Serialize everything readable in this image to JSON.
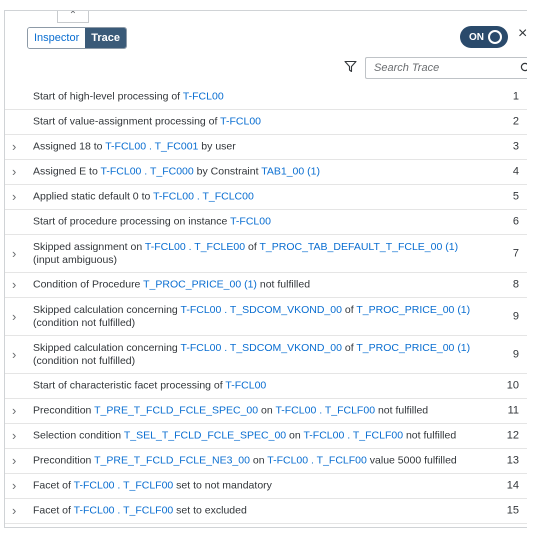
{
  "tabs": {
    "inspector": "Inspector",
    "trace": "Trace"
  },
  "toggle": {
    "label": "ON",
    "state": "on"
  },
  "search": {
    "placeholder": "Search Trace"
  },
  "icons": {
    "collapse": "chevron-up-icon",
    "close": "close-icon",
    "filter": "filter-icon",
    "search": "search-icon",
    "expand": "chevron-right-icon"
  },
  "colors": {
    "link": "#0a6ed1",
    "toggle_bg": "#2a4a6b",
    "active_tab": "#3a5a78"
  },
  "rows": [
    {
      "num": "1",
      "expandable": false,
      "segments": [
        {
          "t": "Start of high-level processing of "
        },
        {
          "t": "T-FCL00",
          "l": true
        }
      ]
    },
    {
      "num": "2",
      "expandable": false,
      "segments": [
        {
          "t": "Start of value-assignment processing of "
        },
        {
          "t": "T-FCL00",
          "l": true
        }
      ]
    },
    {
      "num": "3",
      "expandable": true,
      "segments": [
        {
          "t": "Assigned 18 to "
        },
        {
          "t": "T-FCL00 . T_FC001",
          "l": true
        },
        {
          "t": " by user"
        }
      ]
    },
    {
      "num": "4",
      "expandable": true,
      "segments": [
        {
          "t": "Assigned E to "
        },
        {
          "t": "T-FCL00 . T_FC000",
          "l": true
        },
        {
          "t": " by Constraint "
        },
        {
          "t": "TAB1_00 (1)",
          "l": true
        }
      ]
    },
    {
      "num": "5",
      "expandable": true,
      "segments": [
        {
          "t": "Applied static default 0 to "
        },
        {
          "t": "T-FCL00 . T_FCLC00",
          "l": true
        }
      ]
    },
    {
      "num": "6",
      "expandable": false,
      "segments": [
        {
          "t": "Start of procedure processing on instance "
        },
        {
          "t": "T-FCL00",
          "l": true
        }
      ]
    },
    {
      "num": "7",
      "expandable": true,
      "segments": [
        {
          "t": "Skipped assignment on "
        },
        {
          "t": "T-FCL00 . T_FCLE00",
          "l": true
        },
        {
          "t": " of "
        },
        {
          "t": "T_PROC_TAB_DEFAULT_T_FCLE_00 (1)",
          "l": true
        },
        {
          "t": " (input ambiguous)"
        }
      ]
    },
    {
      "num": "8",
      "expandable": true,
      "segments": [
        {
          "t": "Condition of Procedure "
        },
        {
          "t": "T_PROC_PRICE_00 (1)",
          "l": true
        },
        {
          "t": " not fulfilled"
        }
      ]
    },
    {
      "num": "9",
      "expandable": true,
      "segments": [
        {
          "t": "Skipped calculation concerning "
        },
        {
          "t": "T-FCL00 . T_SDCOM_VKOND_00",
          "l": true
        },
        {
          "t": " of "
        },
        {
          "t": "T_PROC_PRICE_00 (1)",
          "l": true
        },
        {
          "t": " (condition not fulfilled)"
        }
      ]
    },
    {
      "num": "9",
      "expandable": true,
      "segments": [
        {
          "t": "Skipped calculation concerning "
        },
        {
          "t": "T-FCL00 . T_SDCOM_VKOND_00",
          "l": true
        },
        {
          "t": " of "
        },
        {
          "t": "T_PROC_PRICE_00 (1)",
          "l": true
        },
        {
          "t": " (condition not fulfilled)"
        }
      ]
    },
    {
      "num": "10",
      "expandable": false,
      "segments": [
        {
          "t": "Start of characteristic facet processing of "
        },
        {
          "t": "T-FCL00",
          "l": true
        }
      ]
    },
    {
      "num": "11",
      "expandable": true,
      "segments": [
        {
          "t": "Precondition "
        },
        {
          "t": "T_PRE_T_FCLD_FCLE_SPEC_00",
          "l": true
        },
        {
          "t": " on "
        },
        {
          "t": "T-FCL00 . T_FCLF00",
          "l": true
        },
        {
          "t": " not fulfilled"
        }
      ]
    },
    {
      "num": "12",
      "expandable": true,
      "segments": [
        {
          "t": "Selection condition "
        },
        {
          "t": "T_SEL_T_FCLD_FCLE_SPEC_00",
          "l": true
        },
        {
          "t": " on "
        },
        {
          "t": "T-FCL00 . T_FCLF00",
          "l": true
        },
        {
          "t": " not fulfilled"
        }
      ]
    },
    {
      "num": "13",
      "expandable": true,
      "segments": [
        {
          "t": "Precondition "
        },
        {
          "t": "T_PRE_T_FCLD_FCLE_NE3_00",
          "l": true
        },
        {
          "t": " on "
        },
        {
          "t": "T-FCL00 . T_FCLF00",
          "l": true
        },
        {
          "t": " value 5000 fulfilled"
        }
      ]
    },
    {
      "num": "14",
      "expandable": true,
      "segments": [
        {
          "t": "Facet of "
        },
        {
          "t": "T-FCL00 . T_FCLF00",
          "l": true
        },
        {
          "t": " set to not mandatory"
        }
      ]
    },
    {
      "num": "15",
      "expandable": true,
      "segments": [
        {
          "t": "Facet of "
        },
        {
          "t": "T-FCL00 . T_FCLF00",
          "l": true
        },
        {
          "t": " set to excluded"
        }
      ]
    }
  ]
}
